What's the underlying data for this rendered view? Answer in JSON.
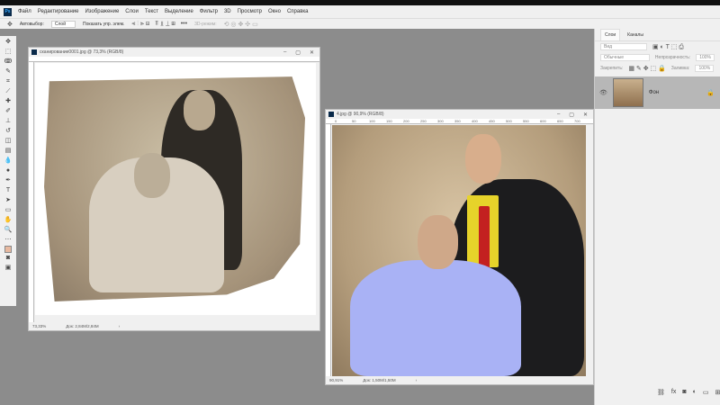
{
  "app": {
    "logo": "Ps"
  },
  "menu": [
    "Файл",
    "Редактирование",
    "Изображение",
    "Слои",
    "Текст",
    "Выделение",
    "Фильтр",
    "3D",
    "Просмотр",
    "Окно",
    "Справка"
  ],
  "options": {
    "autoselect": "Автовыбор:",
    "layer_select": "Слой",
    "show_controls": "Показать упр. элем.",
    "mode3d": "3D-режим:"
  },
  "doc1": {
    "title": "сканирование0001.jpg @ 73,3% (RGB/8)",
    "zoom": "73,33%",
    "doc_size": "Док: 2,84M/2,84M"
  },
  "doc2": {
    "title": "4.jpg @ 90,9% (RGB/8)",
    "zoom": "90,91%",
    "doc_size": "Док: 1,50M/1,50M",
    "ruler": [
      "0",
      "50",
      "100",
      "150",
      "200",
      "250",
      "300",
      "350",
      "400",
      "450",
      "500",
      "550",
      "600",
      "650",
      "700"
    ]
  },
  "panel": {
    "tabs": [
      "Слои",
      "Каналы"
    ],
    "filter": "Вид",
    "blend": "Обычные",
    "opacity_label": "Непрозрачность:",
    "opacity": "100%",
    "lock_label": "Закрепить:",
    "fill_label": "Заливка:",
    "fill": "100%",
    "layer_name": "Фон"
  }
}
